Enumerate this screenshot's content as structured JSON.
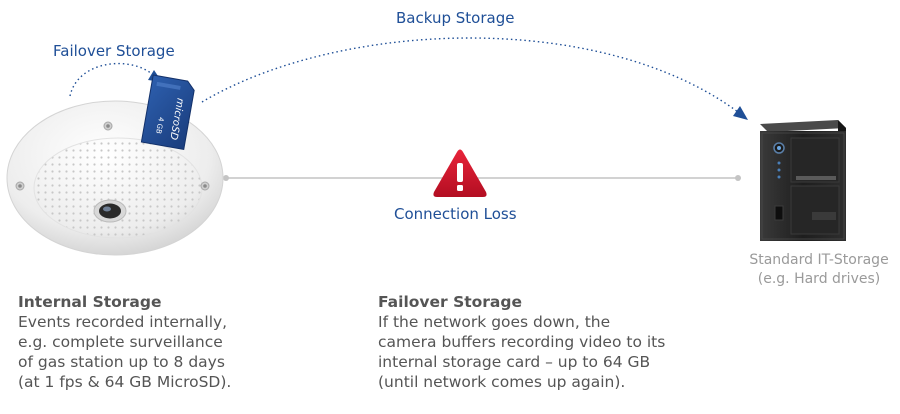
{
  "diagram": {
    "backup_label": "Backup Storage",
    "failover_label": "Failover Storage",
    "connection_label": "Connection Loss",
    "storage_device_label": {
      "line1": "Standard IT-Storage",
      "line2": "(e.g. Hard drives)"
    },
    "sd_card_text": "microSD",
    "sd_card_size": "4 GB",
    "colors": {
      "accent": "#1f4f97",
      "warning": "#d0152b",
      "text_gray": "#555555",
      "label_gray": "#9a9a9a"
    }
  },
  "internal_storage": {
    "title": "Internal Storage",
    "lines": [
      "Events recorded internally,",
      "e.g. complete surveillance",
      "of gas station up to 8 days",
      "(at 1 fps & 64 GB MicroSD)."
    ]
  },
  "failover_storage": {
    "title": "Failover Storage",
    "lines": [
      "If the network goes down, the",
      "camera buffers recording video to its",
      "internal storage card – up to 64 GB",
      "(until network comes up again)."
    ]
  }
}
